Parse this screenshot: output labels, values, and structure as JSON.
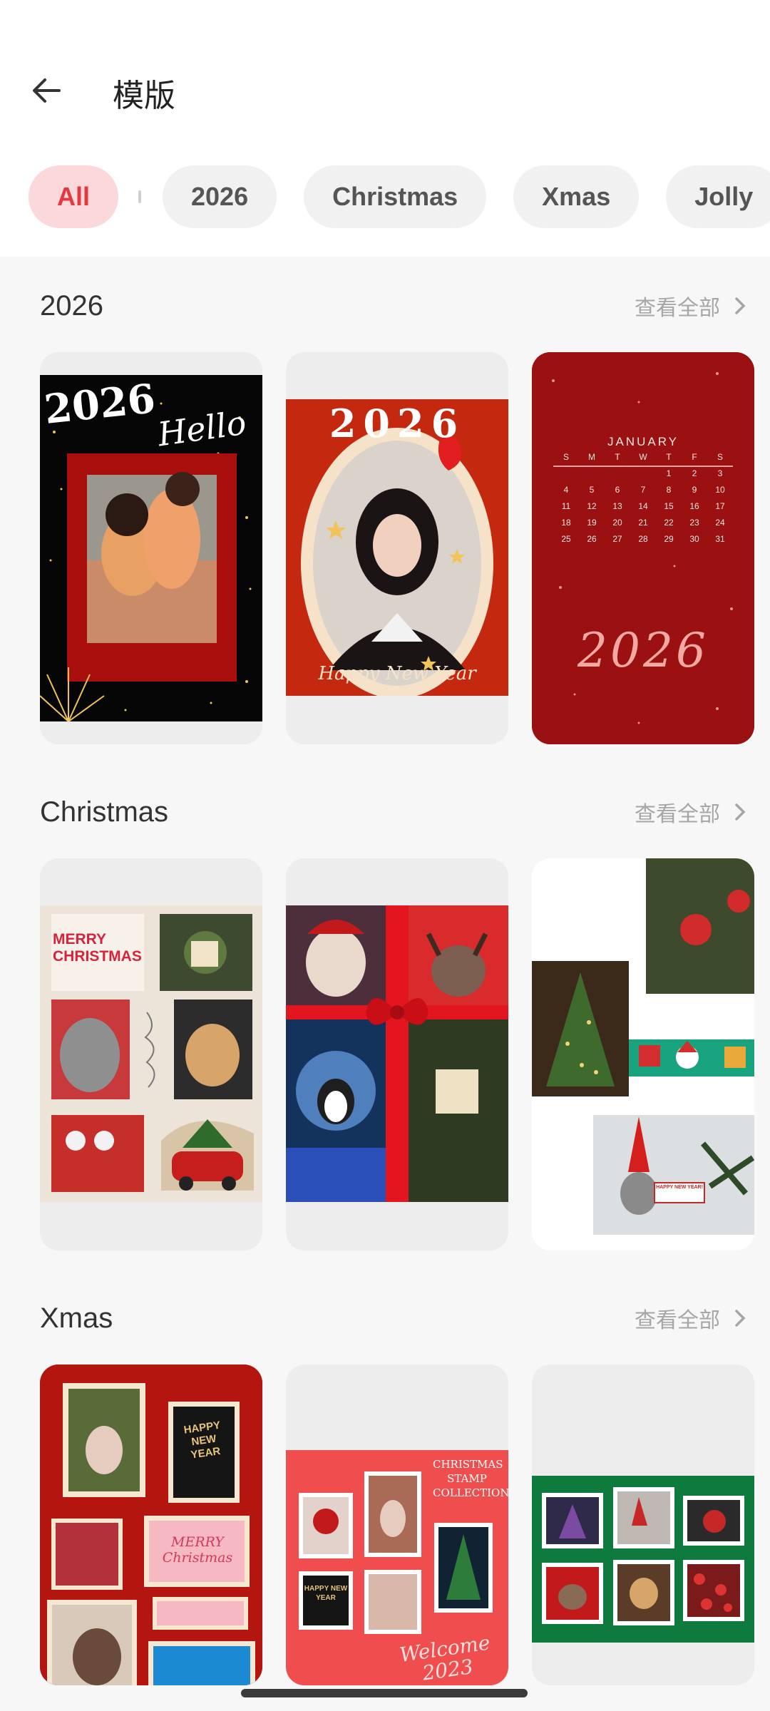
{
  "header": {
    "title": "模版",
    "back_icon": "arrow-left-icon"
  },
  "filters": {
    "chips": [
      "All",
      "2026",
      "Christmas",
      "Xmas",
      "Jolly"
    ],
    "active": "All"
  },
  "sections": [
    {
      "title": "2026",
      "view_all": "查看全部",
      "cards": [
        {
          "text_main": "2026",
          "text_sub": "Hello"
        },
        {
          "text_main": "2026",
          "text_sub": "Happy New Year"
        },
        {
          "month": "JANUARY",
          "weekdays": [
            "S",
            "M",
            "T",
            "W",
            "T",
            "F",
            "S"
          ],
          "days": [
            "1",
            "2",
            "3",
            "4",
            "5",
            "6",
            "7",
            "8",
            "9",
            "10",
            "11",
            "12",
            "13",
            "14",
            "15",
            "16",
            "17",
            "18",
            "19",
            "20",
            "21",
            "22",
            "23",
            "24",
            "25",
            "26",
            "27",
            "28",
            "29",
            "30",
            "31"
          ],
          "year": "2026"
        }
      ]
    },
    {
      "title": "Christmas",
      "view_all": "查看全部",
      "cards": [
        {
          "text_main": "MERRY CHRISTMAS"
        },
        {},
        {
          "text_main": "HAPPY NEW YEAR!"
        }
      ]
    },
    {
      "title": "Xmas",
      "view_all": "查看全部",
      "cards": [
        {
          "text_main": "HAPPY NEW YEAR",
          "text_sub": "MERRY Christmas"
        },
        {
          "text_main": "CHRISTMAS STAMP COLLECTION",
          "text_sub": "Welcome 2023",
          "stamp_text": "HAPPY NEW YEAR"
        },
        {}
      ]
    }
  ],
  "colors": {
    "accent": "#e23a3f",
    "chip_active_bg": "#fbd9db",
    "card_bg": "#ededed",
    "festive_red": "#b5150f",
    "festive_green": "#0f7a3e"
  }
}
